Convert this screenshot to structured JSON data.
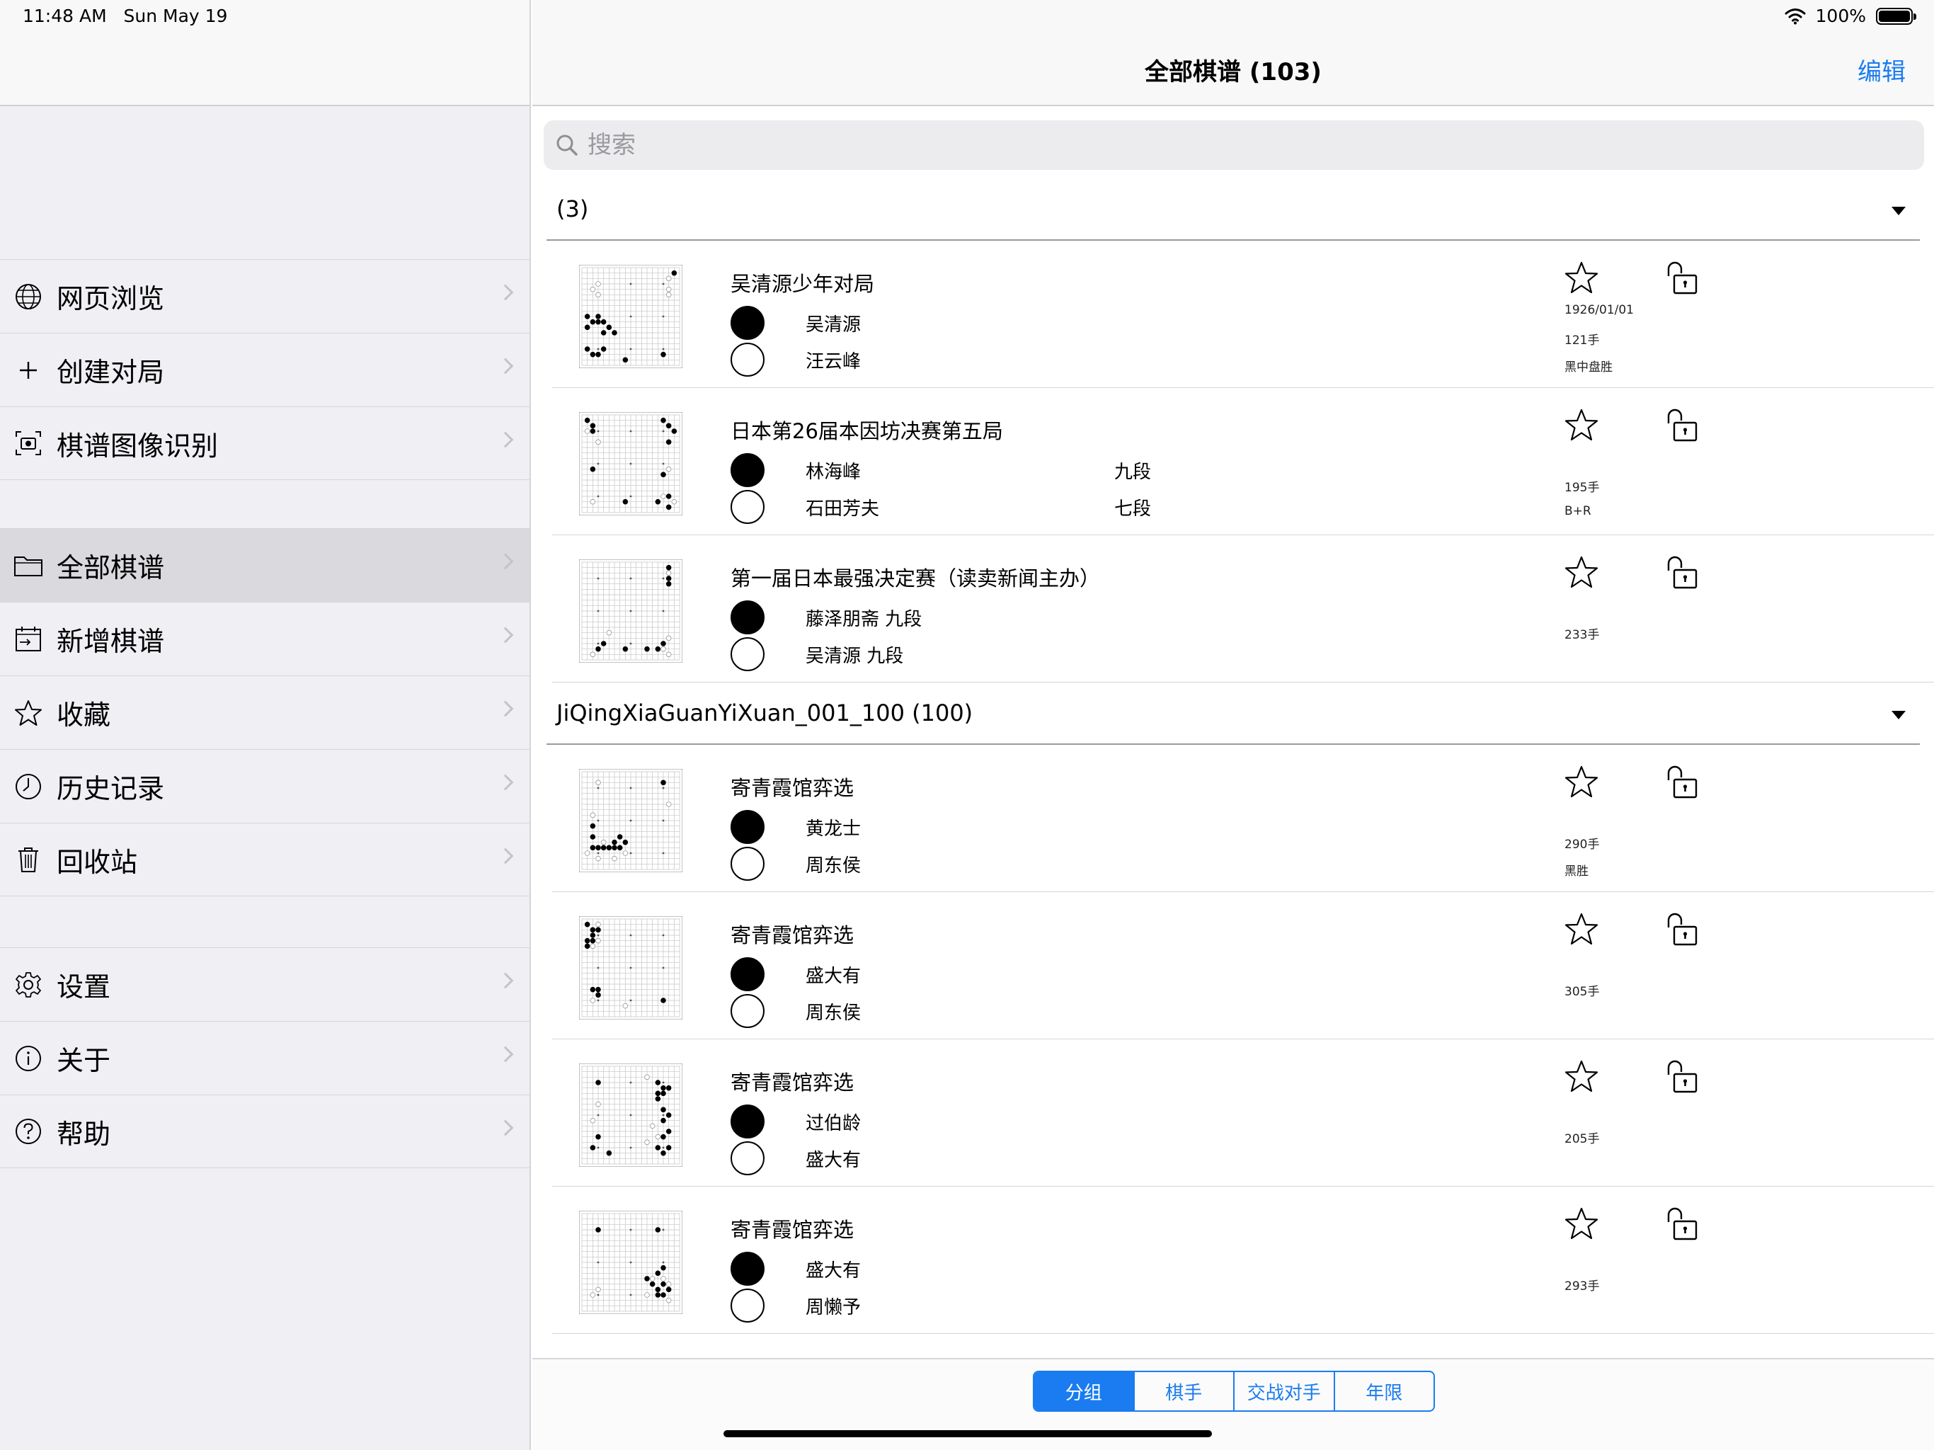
{
  "status": {
    "time": "11:48 AM",
    "date": "Sun May 19",
    "battery": "100%"
  },
  "sidebar": {
    "groups": [
      [
        {
          "label": "网页浏览",
          "icon": "globe-icon"
        },
        {
          "label": "创建对局",
          "icon": "plus-icon"
        },
        {
          "label": "棋谱图像识别",
          "icon": "camera-scan-icon"
        }
      ],
      [
        {
          "label": "全部棋谱",
          "icon": "folder-icon",
          "selected": true
        },
        {
          "label": "新增棋谱",
          "icon": "calendar-add-icon"
        },
        {
          "label": "收藏",
          "icon": "star-icon"
        },
        {
          "label": "历史记录",
          "icon": "clock-icon"
        },
        {
          "label": "回收站",
          "icon": "trash-icon"
        }
      ],
      [
        {
          "label": "设置",
          "icon": "gear-icon"
        },
        {
          "label": "关于",
          "icon": "info-icon"
        },
        {
          "label": "帮助",
          "icon": "help-icon"
        }
      ]
    ]
  },
  "nav": {
    "title": "全部棋谱 (103)",
    "edit": "编辑"
  },
  "search": {
    "placeholder": "搜索"
  },
  "sections": [
    {
      "title": "(3)",
      "games": [
        {
          "title": "吴清源少年对局",
          "black": "吴清源",
          "white": "汪云峰",
          "black_rank": "",
          "white_rank": "",
          "date": "1926/01/01",
          "moves": "121手",
          "result": "黑中盘胜"
        },
        {
          "title": "日本第26届本因坊决赛第五局",
          "black": "林海峰",
          "white": "石田芳夫",
          "black_rank": "九段",
          "white_rank": "七段",
          "date": "",
          "moves": "195手",
          "result": "B+R"
        },
        {
          "title": "第一届日本最强决定赛（读卖新闻主办）",
          "black": "藤泽朋斋 九段",
          "white": "吴清源  九段",
          "black_rank": "",
          "white_rank": "",
          "date": "",
          "moves": "233手",
          "result": ""
        }
      ]
    },
    {
      "title": "JiQingXiaGuanYiXuan_001_100 (100)",
      "games": [
        {
          "title": "寄青霞馆弈选",
          "black": "黄龙士",
          "white": "周东侯",
          "black_rank": "",
          "white_rank": "",
          "date": "",
          "moves": "290手",
          "result": "黑胜"
        },
        {
          "title": "寄青霞馆弈选",
          "black": "盛大有",
          "white": "周东侯",
          "black_rank": "",
          "white_rank": "",
          "date": "",
          "moves": "305手",
          "result": ""
        },
        {
          "title": "寄青霞馆弈选",
          "black": "过伯龄",
          "white": "盛大有",
          "black_rank": "",
          "white_rank": "",
          "date": "",
          "moves": "205手",
          "result": ""
        },
        {
          "title": "寄青霞馆弈选",
          "black": "盛大有",
          "white": "周懒予",
          "black_rank": "",
          "white_rank": "",
          "date": "",
          "moves": "293手",
          "result": ""
        }
      ]
    }
  ],
  "bottom_segments": [
    {
      "label": "分组",
      "active": true
    },
    {
      "label": "棋手",
      "active": false
    },
    {
      "label": "交战对手",
      "active": false
    },
    {
      "label": "年限",
      "active": false
    }
  ]
}
